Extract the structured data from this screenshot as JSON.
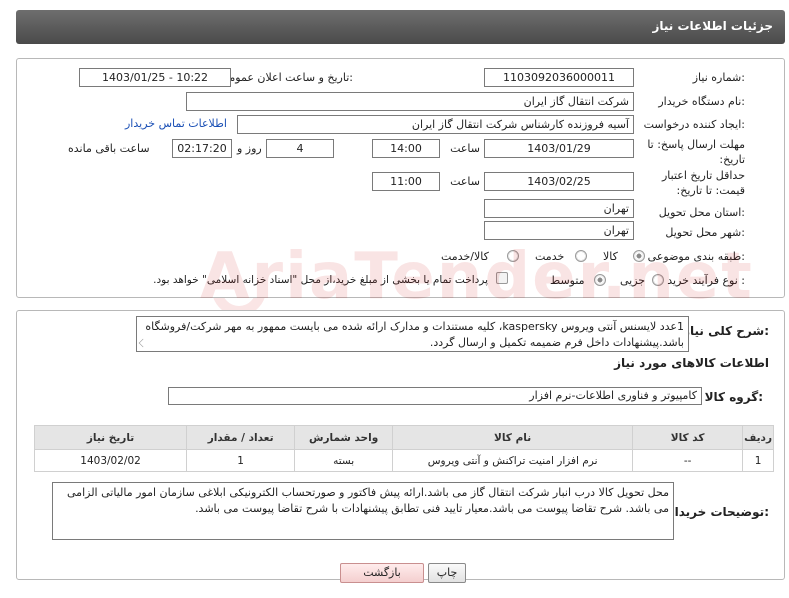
{
  "header": {
    "title": "جزئیات اطلاعات نیاز"
  },
  "form": {
    "need_number_label": "شماره نیاز:",
    "need_number": "1103092036000011",
    "announce_label": "تاریخ و ساعت اعلان عمومی:",
    "announce_value": "1403/01/25 - 10:22",
    "buyer_label": "نام دستگاه خریدار:",
    "buyer_value": "شرکت انتقال گاز ایران",
    "creator_label": "ایجاد کننده درخواست:",
    "creator_value": "آسیه فروزنده کارشناس شرکت انتقال گاز ایران",
    "contact_link": "اطلاعات تماس خریدار",
    "deadline_label": "مهلت ارسال پاسخ: تا تاریخ:",
    "deadline_date": "1403/01/29",
    "time_label": "ساعت",
    "deadline_time": "14:00",
    "days_value": "4",
    "days_label": "روز و",
    "remaining_time": "02:17:20",
    "remaining_label": "ساعت باقی مانده",
    "validity_label": "حداقل تاریخ اعتبار قیمت: تا تاریخ:",
    "validity_date": "1403/02/25",
    "validity_time": "11:00",
    "province_label": "استان محل تحویل:",
    "province_value": "تهران",
    "city_label": "شهر محل تحویل:",
    "city_value": "تهران",
    "category_label": "طبقه بندی موضوعی:",
    "category_options": [
      "کالا",
      "خدمت",
      "کالا/خدمت"
    ],
    "process_label": "نوع فرآیند خرید :",
    "process_options": [
      "جزیی",
      "متوسط"
    ],
    "payment_note": "پرداخت تمام یا بخشی از مبلغ خرید،از محل \"اسناد خزانه اسلامی\" خواهد بود."
  },
  "description": {
    "label": "شرح کلی نیاز:",
    "text": "1عدد لایسنس آنتی ویروس kaspersky، کلیه مستندات و مدارک ارائه شده می بایست ممهور به مهر شرکت/فروشگاه باشد.پیشنهادات داخل فرم ضمیمه تکمیل و ارسال گردد."
  },
  "goods": {
    "title": "اطلاعات کالاهای مورد نیاز",
    "group_label": "گروه کالا:",
    "group_value": "کامپیوتر و فناوری اطلاعات-نرم افزار",
    "columns": [
      "ردیف",
      "کد کالا",
      "نام کالا",
      "واحد شمارش",
      "تعداد / مقدار",
      "تاریخ نیاز"
    ],
    "rows": [
      {
        "row": "1",
        "code": "--",
        "name": "نرم افزار امنیت تراکنش و آنتی ویروس",
        "unit": "بسته",
        "qty": "1",
        "date": "1403/02/02"
      }
    ]
  },
  "buyer_notes": {
    "label": "توضیحات خریدار:",
    "text": "محل تحویل کالا درب انبار شرکت انتقال گاز می باشد.ارائه پیش فاکتور و صورتحساب الکترونیکی ابلاغی سازمان امور مالیاتی الزامی می باشد. شرح تقاضا پیوست می باشد.معیار تایید فنی تطابق پیشنهادات با شرح تقاضا پیوست می باشد."
  },
  "buttons": {
    "print": "چاپ",
    "back": "بازگشت"
  },
  "colors": {
    "header": "#5a5a5a",
    "link": "#1a4fb5",
    "back_button": "#f4cfcf"
  }
}
